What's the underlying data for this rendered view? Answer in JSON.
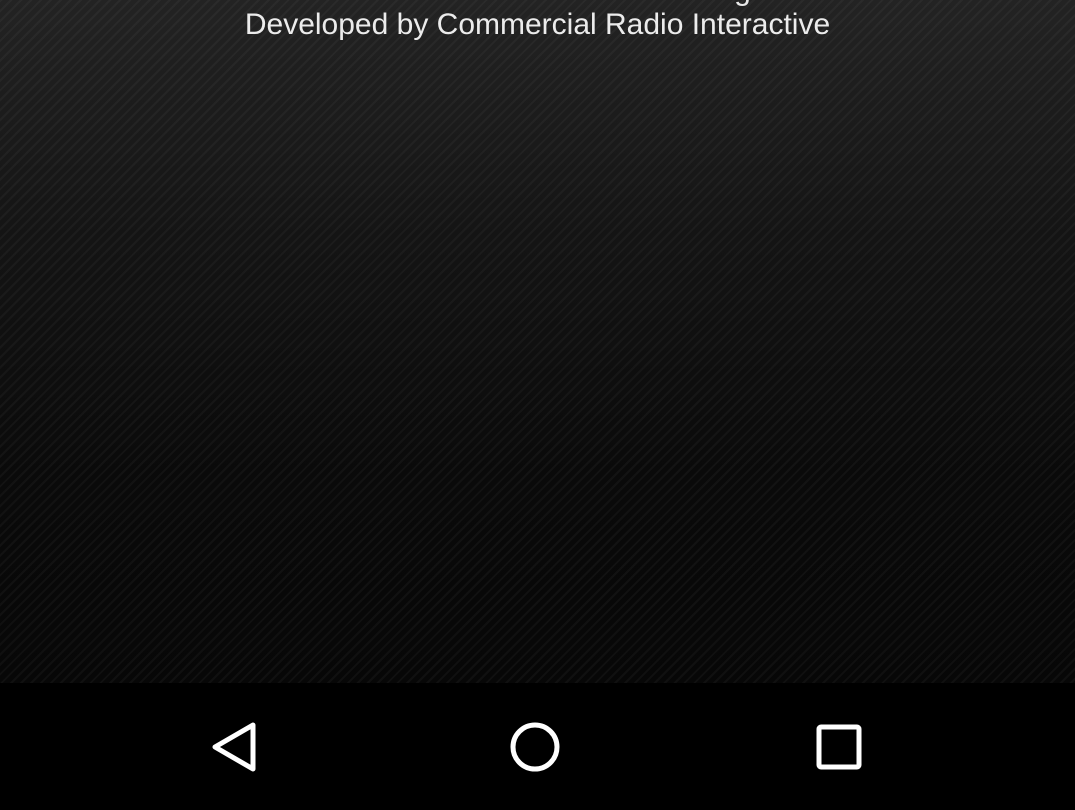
{
  "app": {
    "top_line_partial": "g",
    "credit_text": "Developed by Commercial Radio Interactive"
  },
  "navigation_bar": {
    "buttons": [
      {
        "name": "back",
        "icon": "back-triangle-icon"
      },
      {
        "name": "home",
        "icon": "home-circle-icon"
      },
      {
        "name": "recents",
        "icon": "recents-square-icon"
      }
    ],
    "icon_color": "#ffffff",
    "background_color": "#000000"
  }
}
